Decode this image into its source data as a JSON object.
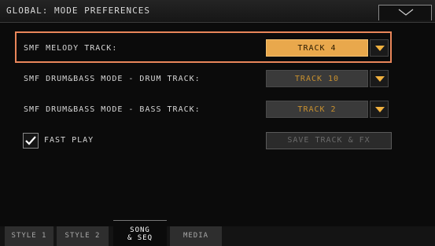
{
  "header": {
    "title": "GLOBAL: MODE PREFERENCES",
    "menu_icon": "chevron-down-icon"
  },
  "settings": {
    "melody_track": {
      "label": "SMF MELODY TRACK:",
      "value": "TRACK 4"
    },
    "drum_track": {
      "label": "SMF DRUM&BASS MODE - DRUM TRACK:",
      "value": "TRACK 10"
    },
    "bass_track": {
      "label": "SMF DRUM&BASS MODE - BASS TRACK:",
      "value": "TRACK 2"
    },
    "fast_play": {
      "label": "FAST PLAY",
      "checked": true
    },
    "save_button_label": "SAVE TRACK & FX"
  },
  "tabs": [
    {
      "label": "STYLE 1",
      "selected": false
    },
    {
      "label": "STYLE 2",
      "selected": false
    },
    {
      "label_line1": "SONG",
      "label_line2": "& SEQ",
      "selected": true
    },
    {
      "label": "MEDIA",
      "selected": false
    }
  ],
  "colors": {
    "highlight_border": "#e9865a",
    "active_dropdown": "#e9a84c",
    "dim_dropdown_text": "#c8902e",
    "arrow": "#f1b13f"
  }
}
